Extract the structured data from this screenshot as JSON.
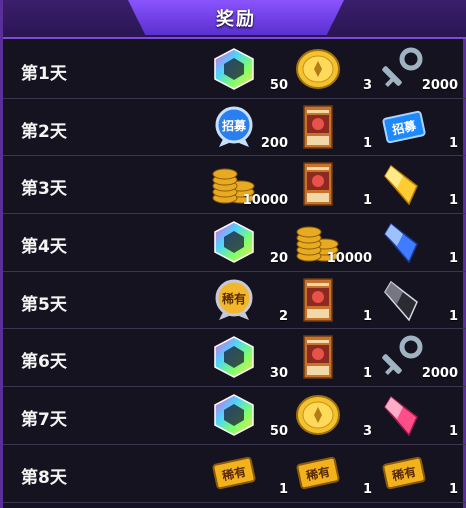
{
  "header": {
    "title": "奖励"
  },
  "days": [
    {
      "label": "第1天",
      "rewards": [
        {
          "icon": "rainbow-gem-icon",
          "count": "50"
        },
        {
          "icon": "gold-coin-icon",
          "count": "3"
        },
        {
          "icon": "silver-key-icon",
          "count": "2000"
        }
      ]
    },
    {
      "label": "第2天",
      "rewards": [
        {
          "icon": "blue-badge-icon",
          "count": "200"
        },
        {
          "icon": "monster-card-icon",
          "count": "1"
        },
        {
          "icon": "blue-ticket-icon",
          "count": "1"
        }
      ]
    },
    {
      "label": "第3天",
      "rewards": [
        {
          "icon": "coin-stack-icon",
          "count": "10000"
        },
        {
          "icon": "monster-card-icon",
          "count": "1"
        },
        {
          "icon": "yellow-crystal-icon",
          "count": "1"
        }
      ]
    },
    {
      "label": "第4天",
      "rewards": [
        {
          "icon": "rainbow-gem-icon",
          "count": "20"
        },
        {
          "icon": "coin-stack-icon",
          "count": "10000"
        },
        {
          "icon": "blue-crystal-icon",
          "count": "1"
        }
      ]
    },
    {
      "label": "第5天",
      "rewards": [
        {
          "icon": "gold-badge-icon",
          "count": "2"
        },
        {
          "icon": "monster-card-icon",
          "count": "1"
        },
        {
          "icon": "black-crystal-icon",
          "count": "1"
        }
      ]
    },
    {
      "label": "第6天",
      "rewards": [
        {
          "icon": "rainbow-gem-icon",
          "count": "30"
        },
        {
          "icon": "monster-card-icon",
          "count": "1"
        },
        {
          "icon": "silver-key-icon",
          "count": "2000"
        }
      ]
    },
    {
      "label": "第7天",
      "rewards": [
        {
          "icon": "rainbow-gem-icon",
          "count": "50"
        },
        {
          "icon": "gold-coin-icon",
          "count": "3"
        },
        {
          "icon": "pink-crystal-icon",
          "count": "1"
        }
      ]
    },
    {
      "label": "第8天",
      "rewards": [
        {
          "icon": "gold-ticket-icon",
          "count": "1"
        },
        {
          "icon": "gold-ticket-icon",
          "count": "1"
        },
        {
          "icon": "gold-ticket-icon",
          "count": "1"
        }
      ]
    }
  ],
  "icon_text": {
    "blue_badge": "招募",
    "blue_ticket": "招募",
    "gold_badge": "稀有",
    "gold_ticket": "稀有"
  }
}
